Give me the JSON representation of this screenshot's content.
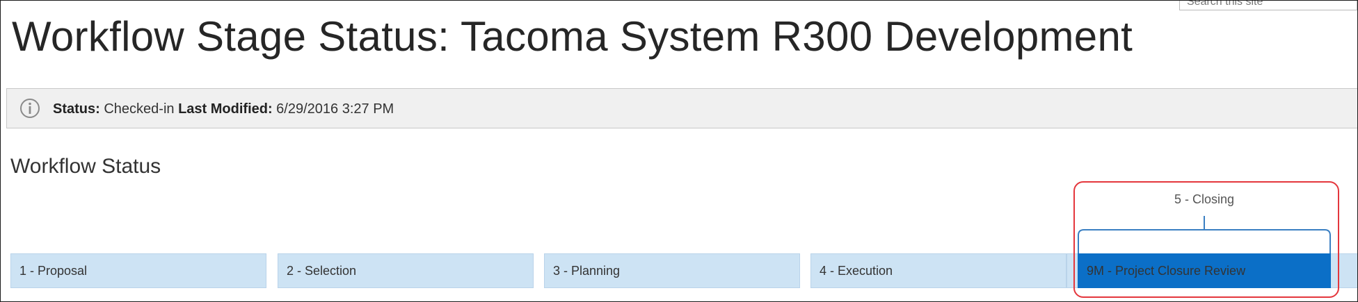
{
  "search": {
    "placeholder": "Search this site"
  },
  "page": {
    "title": "Workflow Stage Status: Tacoma System R300 Development"
  },
  "status_bar": {
    "icon": "info-icon",
    "status_label": "Status:",
    "status_value": " Checked-in ",
    "modified_label": "Last Modified:",
    "modified_value": " 6/29/2016 3:27 PM"
  },
  "workflow": {
    "heading": "Workflow Status",
    "current_stage_group": "5 - Closing",
    "stages": [
      {
        "label": "1 - Proposal"
      },
      {
        "label": "2 - Selection"
      },
      {
        "label": "3 - Planning"
      },
      {
        "label": "4 - Execution"
      },
      {
        "label": "9M - Project Closure Review",
        "active": true
      }
    ]
  },
  "colors": {
    "stage_background": "#cde3f4",
    "active_stage": "#0b6fc7",
    "highlight_annotation": "#e4363c",
    "status_bar_background": "#f0f0f0"
  }
}
